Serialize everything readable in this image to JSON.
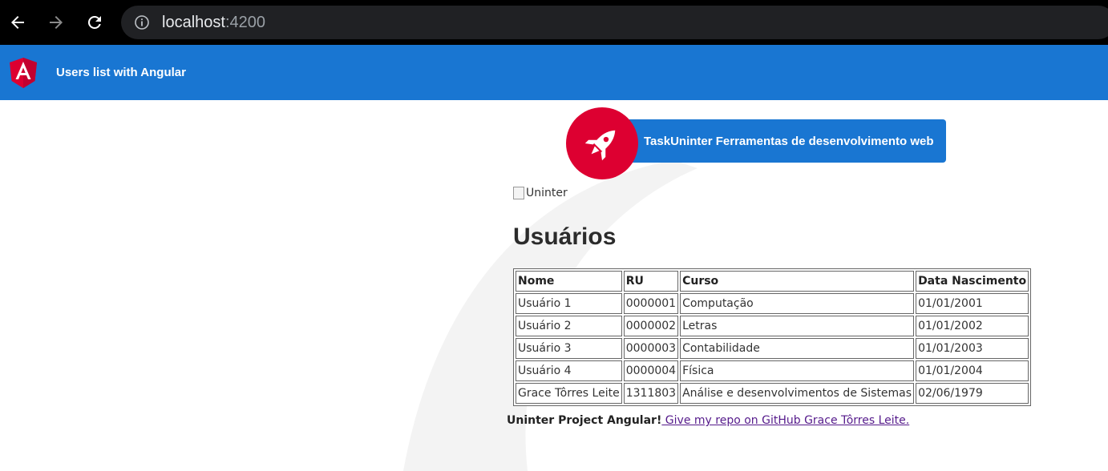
{
  "browser": {
    "url_host": "localhost",
    "url_port": ":4200",
    "back_icon": "back-arrow-icon",
    "forward_icon": "forward-arrow-icon",
    "reload_icon": "reload-icon",
    "info_icon": "info-icon"
  },
  "toolbar": {
    "title": "Users list with Angular",
    "logo_icon": "angular-logo-icon",
    "color": "#1976d2"
  },
  "card": {
    "label": "TaskUninter Ferramentas de desenvolvimento web",
    "icon": "rocket-icon",
    "icon_bg": "#dd0031"
  },
  "image": {
    "alt": "Uninter"
  },
  "main": {
    "heading": "Usuários"
  },
  "table": {
    "headers": [
      "Nome",
      "RU",
      "Curso",
      "Data Nascimento"
    ],
    "rows": [
      [
        "Usuário 1",
        "0000001",
        "Computação",
        "01/01/2001"
      ],
      [
        "Usuário 2",
        "0000002",
        "Letras",
        "01/01/2002"
      ],
      [
        "Usuário 3",
        "0000003",
        "Contabilidade",
        "01/01/2003"
      ],
      [
        "Usuário 4",
        "0000004",
        "Física",
        "01/01/2004"
      ],
      [
        "Grace Tôrres Leite",
        "1311803",
        "Análise e desenvolvimentos de Sistemas",
        "02/06/1979"
      ]
    ]
  },
  "footer": {
    "text": "Uninter Project Angular!",
    "link": " Give my repo on GitHub Grace Tôrres Leite."
  }
}
